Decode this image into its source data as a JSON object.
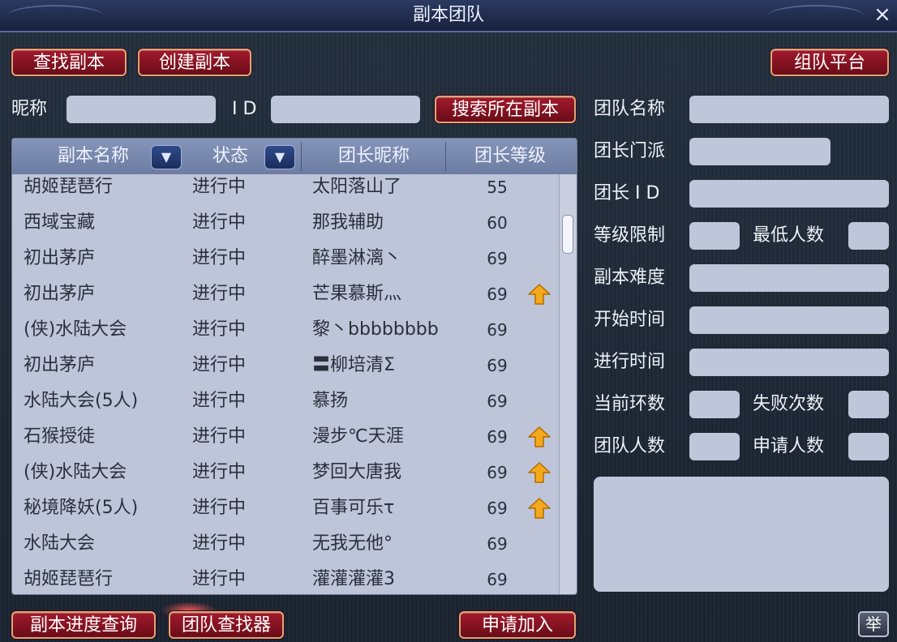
{
  "window": {
    "title": "副本团队",
    "close_icon": "×"
  },
  "top_buttons": {
    "find": "查找副本",
    "create": "创建副本",
    "platform": "组队平台"
  },
  "search": {
    "nickname_label": "昵称",
    "id_label": "I D",
    "nickname_value": "",
    "id_value": "",
    "search_button": "搜索所在副本"
  },
  "list": {
    "headers": {
      "name": "副本名称",
      "status": "状态",
      "leader": "团长昵称",
      "level": "团长等级"
    },
    "rows": [
      {
        "name": "胡姬琵琶行",
        "status": "进行中",
        "leader": "太阳落山了",
        "level": "55",
        "arrow": false
      },
      {
        "name": "西域宝藏",
        "status": "进行中",
        "leader": "那我辅助",
        "level": "60",
        "arrow": false
      },
      {
        "name": "初出茅庐",
        "status": "进行中",
        "leader": "醉墨淋漓丶",
        "level": "69",
        "arrow": false
      },
      {
        "name": "初出茅庐",
        "status": "进行中",
        "leader": "芒果慕斯灬",
        "level": "69",
        "arrow": true
      },
      {
        "name": "(侠)水陆大会",
        "status": "进行中",
        "leader": "黎丶bbbbbbbb",
        "level": "69",
        "arrow": false
      },
      {
        "name": "初出茅庐",
        "status": "进行中",
        "leader": "〓柳培清Σ",
        "level": "69",
        "arrow": false
      },
      {
        "name": "水陆大会(5人)",
        "status": "进行中",
        "leader": "慕扬",
        "level": "69",
        "arrow": false
      },
      {
        "name": "石猴授徒",
        "status": "进行中",
        "leader": "漫步℃天涯",
        "level": "69",
        "arrow": true
      },
      {
        "name": "(侠)水陆大会",
        "status": "进行中",
        "leader": "梦回大唐我",
        "level": "69",
        "arrow": true
      },
      {
        "name": "秘境降妖(5人)",
        "status": "进行中",
        "leader": "百事可乐τ",
        "level": "69",
        "arrow": true
      },
      {
        "name": "水陆大会",
        "status": "进行中",
        "leader": "无我无他°",
        "level": "69",
        "arrow": false
      },
      {
        "name": "胡姬琵琶行",
        "status": "进行中",
        "leader": "灌灌灌灌3",
        "level": "69",
        "arrow": false
      }
    ]
  },
  "detail": {
    "team_name": "团队名称",
    "leader_school": "团长门派",
    "leader_id": "团长 I D",
    "level_limit": "等级限制",
    "min_members": "最低人数",
    "difficulty": "副本难度",
    "start_time": "开始时间",
    "elapsed_time": "进行时间",
    "current_round": "当前环数",
    "fail_count": "失败次数",
    "team_size": "团队人数",
    "applicants": "申请人数"
  },
  "bottom_buttons": {
    "progress": "副本进度查询",
    "finder": "团队查找器",
    "apply": "申请加入",
    "report": "举"
  },
  "colors": {
    "button": "#8f1525",
    "panel": "#bec6da",
    "arrow": "#f4a81c"
  }
}
